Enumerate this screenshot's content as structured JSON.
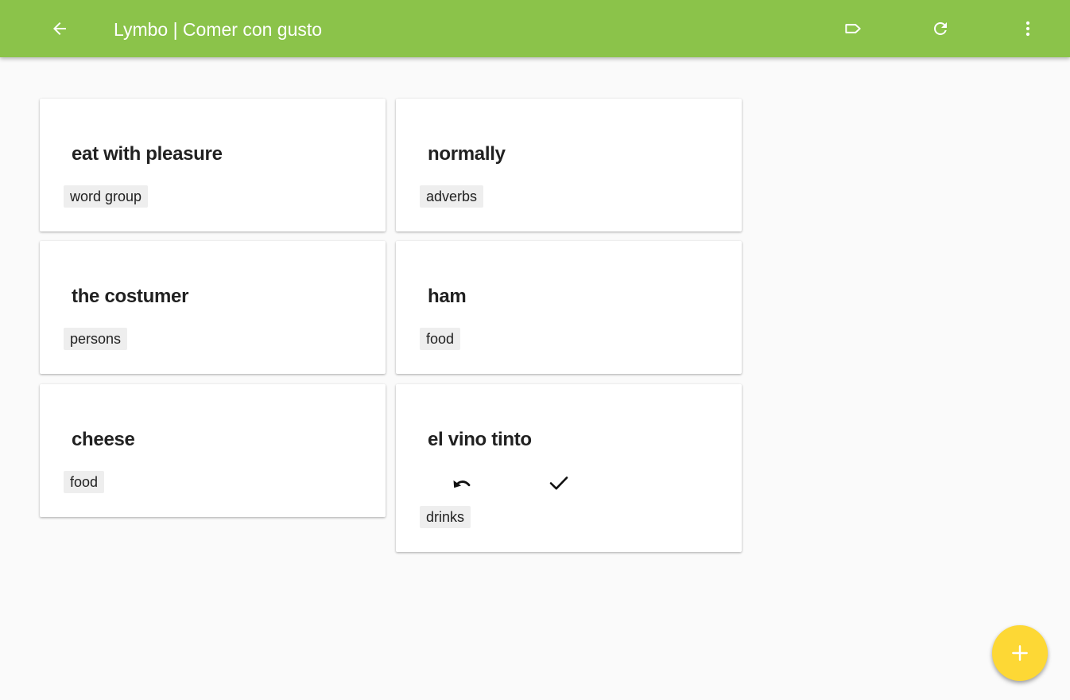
{
  "toolbar": {
    "title": "Lymbo | Comer con gusto",
    "back_icon": "arrow-left-icon",
    "label_icon": "label-outline-icon",
    "refresh_icon": "refresh-icon",
    "more_icon": "more-vert-icon",
    "background_color": "#8bc34a"
  },
  "cards": [
    {
      "word": "eat with pleasure",
      "tag": "word group"
    },
    {
      "word": "normally",
      "tag": "adverbs"
    },
    {
      "word": "the costumer",
      "tag": "persons"
    },
    {
      "word": "ham",
      "tag": "food"
    },
    {
      "word": "cheese",
      "tag": "food"
    },
    {
      "word": "el vino tinto",
      "tag": "drinks",
      "actions": [
        "undo-icon",
        "check-icon"
      ]
    }
  ],
  "fab": {
    "icon": "plus-icon",
    "color": "#fdd835"
  }
}
